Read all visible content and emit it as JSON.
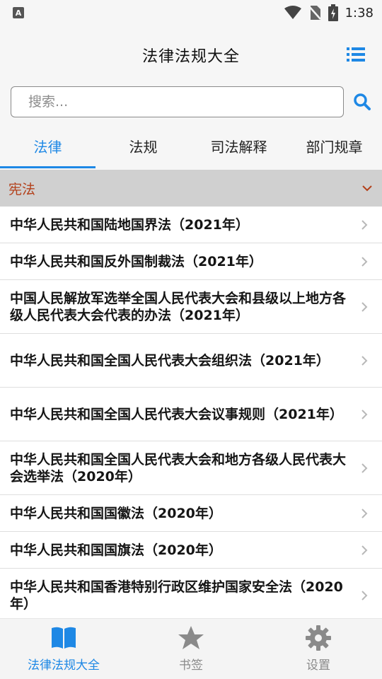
{
  "status_bar": {
    "time": "1:38",
    "left_icon": "A",
    "icons": [
      "wifi-icon",
      "no-sim-icon",
      "battery-icon"
    ]
  },
  "header": {
    "title": "法律法规大全",
    "menu_icon": "list-icon"
  },
  "search": {
    "placeholder": "搜索...",
    "value": "",
    "icon": "search-icon"
  },
  "tabs": [
    {
      "label": "法律",
      "active": true
    },
    {
      "label": "法规",
      "active": false
    },
    {
      "label": "司法解释",
      "active": false
    },
    {
      "label": "部门规章",
      "active": false
    }
  ],
  "section": {
    "title": "宪法",
    "icon": "chevron-down-icon"
  },
  "items": [
    {
      "text": "中华人民共和国陆地国界法（2021年）"
    },
    {
      "text": "中华人民共和国反外国制裁法（2021年）"
    },
    {
      "text": "中国人民解放军选举全国人民代表大会和县级以上地方各级人民代表大会代表的办法（2021年）"
    },
    {
      "text": "中华人民共和国全国人民代表大会组织法（2021年）"
    },
    {
      "text": "中华人民共和国全国人民代表大会议事规则（2021年）"
    },
    {
      "text": "中华人民共和国全国人民代表大会和地方各级人民代表大会选举法（2020年）"
    },
    {
      "text": "中华人民共和国国徽法（2020年）"
    },
    {
      "text": "中华人民共和国国旗法（2020年）"
    },
    {
      "text": "中华人民共和国香港特别行政区维护国家安全法（2020年）"
    }
  ],
  "bottom_nav": [
    {
      "label": "法律法规大全",
      "icon": "book-icon",
      "active": true
    },
    {
      "label": "书签",
      "icon": "star-icon",
      "active": false
    },
    {
      "label": "设置",
      "icon": "gear-icon",
      "active": false
    }
  ],
  "colors": {
    "accent": "#1e88e5",
    "section_text": "#b3401a",
    "section_bg": "#d0d0d0"
  }
}
